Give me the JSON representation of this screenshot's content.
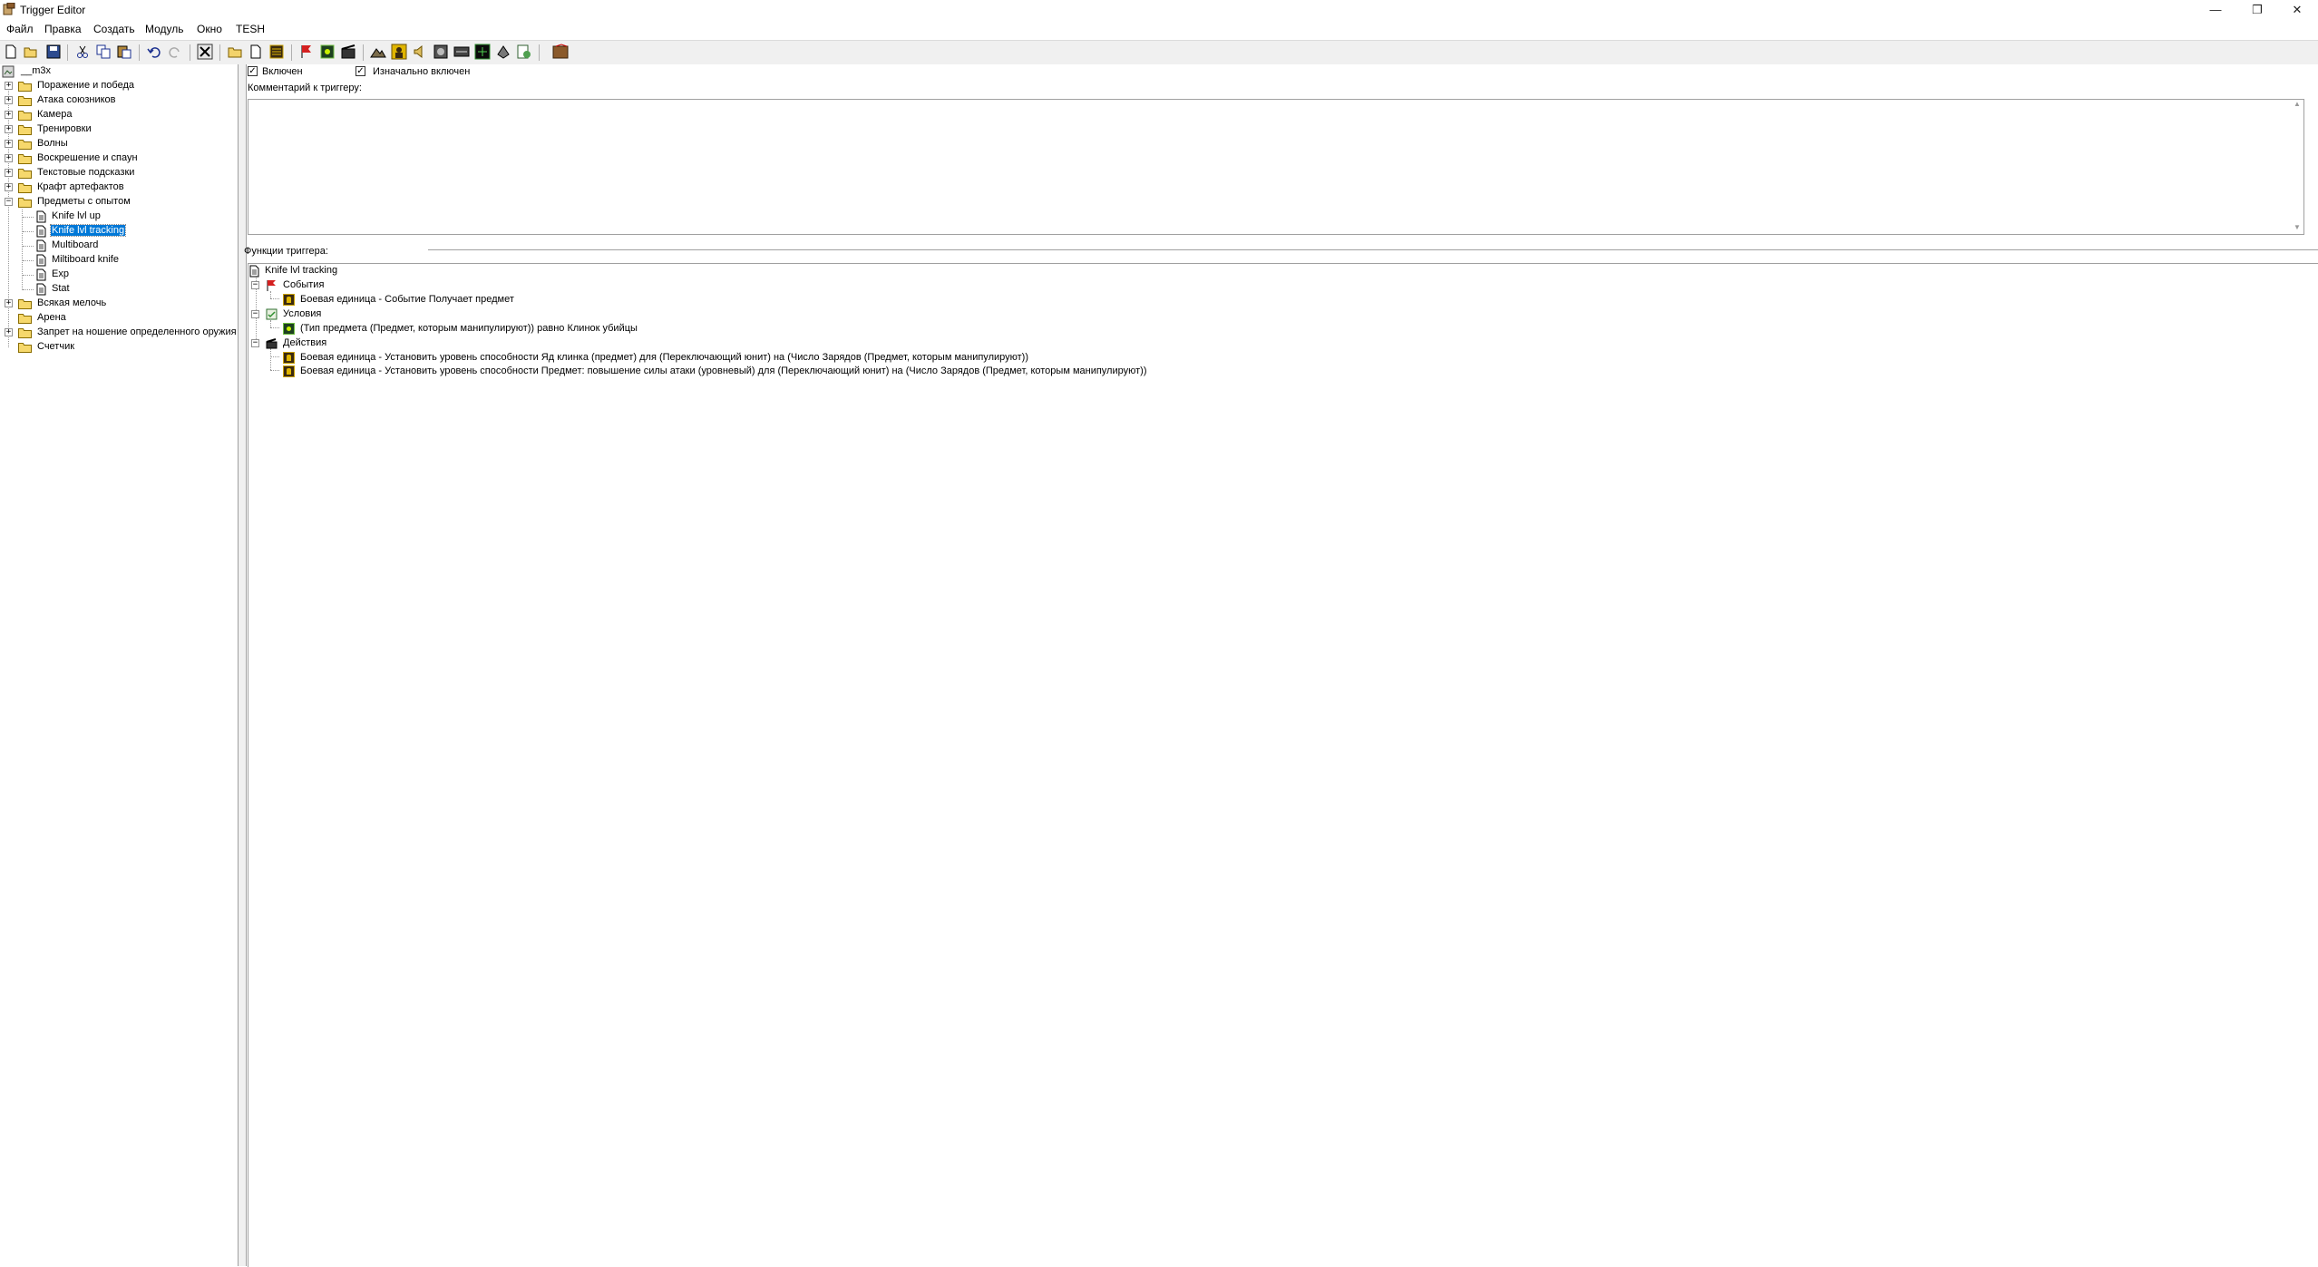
{
  "window": {
    "title": "Trigger Editor"
  },
  "menu": [
    "Файл",
    "Правка",
    "Создать",
    "Модуль",
    "Окно",
    "TESH"
  ],
  "toolbar": {
    "icons": [
      "new-icon",
      "open-icon",
      "save-icon",
      "cut-icon",
      "copy-icon",
      "paste-icon",
      "undo-icon",
      "redo-icon",
      "delete-icon",
      "new-category-icon",
      "new-trigger-icon",
      "new-comment-icon",
      "new-event-icon",
      "new-condition-icon",
      "new-action-icon",
      "terrain-editor-icon",
      "unit-editor-icon",
      "sound-editor-icon",
      "object-editor-icon",
      "ai-editor-icon",
      "import-manager-icon",
      "script-editor-icon",
      "object-manager-icon",
      "test-map-icon"
    ]
  },
  "tree": {
    "root": "__m3x",
    "items": [
      {
        "label": "Поражение и победа",
        "type": "folder",
        "expander": "+"
      },
      {
        "label": "Атака союзников",
        "type": "folder",
        "expander": "+"
      },
      {
        "label": "Камера",
        "type": "folder",
        "expander": "+"
      },
      {
        "label": "Тренировки",
        "type": "folder",
        "expander": "+"
      },
      {
        "label": "Волны",
        "type": "folder",
        "expander": "+"
      },
      {
        "label": "Воскрешение и спаун",
        "type": "folder",
        "expander": "+"
      },
      {
        "label": "Текстовые подсказки",
        "type": "folder",
        "expander": "+"
      },
      {
        "label": "Крафт артефактов",
        "type": "folder",
        "expander": "+"
      },
      {
        "label": "Предметы с опытом",
        "type": "folder",
        "expander": "−"
      },
      {
        "label": "Knife lvl up",
        "type": "trigger",
        "expander": ""
      },
      {
        "label": "Knife lvl tracking",
        "type": "trigger",
        "expander": "",
        "selected": true
      },
      {
        "label": "Multiboard",
        "type": "trigger",
        "expander": ""
      },
      {
        "label": "Miltiboard knife",
        "type": "trigger",
        "expander": ""
      },
      {
        "label": "Exp",
        "type": "trigger",
        "expander": ""
      },
      {
        "label": "Stat",
        "type": "trigger",
        "expander": ""
      },
      {
        "label": "Всякая мелочь",
        "type": "folder",
        "expander": "+"
      },
      {
        "label": "Арена",
        "type": "folder",
        "expander": ""
      },
      {
        "label": "Запрет на ношение определенного оружия",
        "type": "folder",
        "expander": "+"
      },
      {
        "label": "Счетчик",
        "type": "folder",
        "expander": ""
      }
    ]
  },
  "trigger": {
    "enabled_label": "Включен",
    "enabled": true,
    "initially_on_label": "Изначально включен",
    "initially_on": true,
    "comment_label": "Комментарий к триггеру:",
    "comment_value": "",
    "functions_label": "Функции триггера:",
    "name": "Knife lvl tracking",
    "events_label": "События",
    "event": "Боевая единица - Событие Получает предмет",
    "conditions_label": "Условия",
    "condition": "(Тип предмета (Предмет, которым манипулируют)) равно Клинок убийцы",
    "actions_label": "Действия",
    "actions": [
      "Боевая единица - Установить уровень способности Яд клинка (предмет) для (Переключающий юнит) на (Число Зарядов (Предмет, которым манипулируют))",
      "Боевая единица - Установить уровень способности Предмет: повышение силы атаки (уровневый) для (Переключающий юнит) на (Число Зарядов (Предмет, которым манипулируют))"
    ]
  }
}
